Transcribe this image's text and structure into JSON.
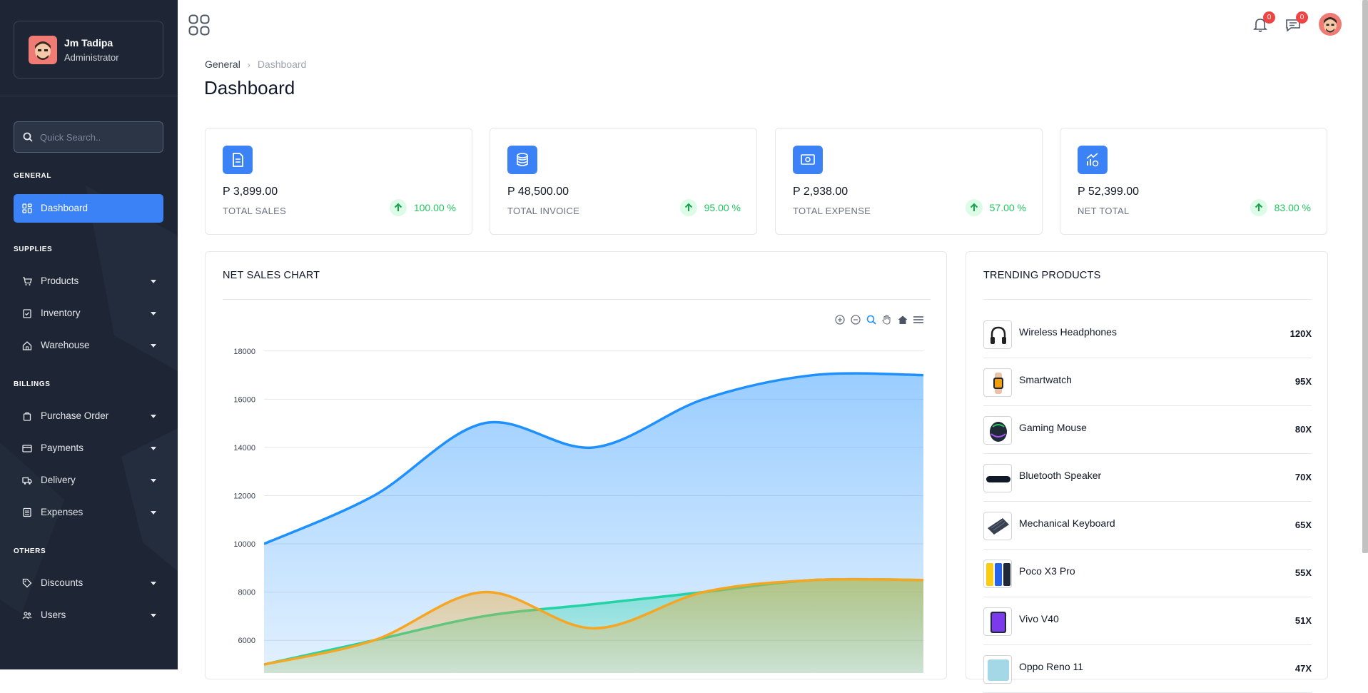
{
  "sidebar": {
    "profile": {
      "name": "Jm Tadipa",
      "role": "Administrator"
    },
    "search": {
      "placeholder": "Quick Search.."
    },
    "sections": [
      {
        "title": "GENERAL"
      },
      {
        "title": "SUPPLIES"
      },
      {
        "title": "BILLINGS"
      },
      {
        "title": "OTHERS"
      }
    ],
    "items": [
      {
        "label": "Dashboard",
        "icon": "grid-icon",
        "active": true
      },
      {
        "label": "Products",
        "icon": "cart-icon"
      },
      {
        "label": "Inventory",
        "icon": "clipboard-icon"
      },
      {
        "label": "Warehouse",
        "icon": "home-icon"
      },
      {
        "label": "Purchase Order",
        "icon": "bag-icon"
      },
      {
        "label": "Payments",
        "icon": "credit-card-icon"
      },
      {
        "label": "Delivery",
        "icon": "truck-icon"
      },
      {
        "label": "Expenses",
        "icon": "list-icon"
      },
      {
        "label": "Discounts",
        "icon": "tag-icon"
      },
      {
        "label": "Users",
        "icon": "users-icon"
      }
    ]
  },
  "topbar": {
    "notifications_count": "0",
    "messages_count": "0"
  },
  "breadcrumb": {
    "root": "General",
    "current": "Dashboard"
  },
  "page_title": "Dashboard",
  "stats": [
    {
      "amount": "P 3,899.00",
      "label": "TOTAL SALES",
      "percent": "100.00 %",
      "icon": "document-icon"
    },
    {
      "amount": "P 48,500.00",
      "label": "TOTAL INVOICE",
      "percent": "95.00 %",
      "icon": "coins-icon"
    },
    {
      "amount": "P 2,938.00",
      "label": "TOTAL EXPENSE",
      "percent": "57.00 %",
      "icon": "cash-icon"
    },
    {
      "amount": "P 52,399.00",
      "label": "NET TOTAL",
      "percent": "83.00 %",
      "icon": "growth-icon"
    }
  ],
  "net_sales": {
    "title": "NET SALES CHART"
  },
  "chart_data": {
    "type": "area",
    "title": "",
    "xlabel": "",
    "ylabel": "",
    "ylim": [
      5000,
      19000
    ],
    "yticks": [
      6000,
      8000,
      10000,
      12000,
      14000,
      16000,
      18000
    ],
    "grid": true,
    "x": [
      0,
      1,
      2,
      3,
      4,
      5,
      6
    ],
    "series": [
      {
        "values": [
          10000,
          12000,
          15000,
          14000,
          16000,
          17000,
          17000
        ],
        "color": "#1e90ff"
      },
      {
        "values": [
          5000,
          6000,
          7000,
          7500,
          8000,
          8500,
          8500
        ],
        "color": "#22d3a5"
      },
      {
        "values": [
          5000,
          6000,
          8000,
          6500,
          8000,
          8500,
          8500
        ],
        "color": "#f5a623"
      }
    ]
  },
  "trending": {
    "title": "TRENDING PRODUCTS",
    "products": [
      {
        "name": "Wireless Headphones",
        "qty": "120X"
      },
      {
        "name": "Smartwatch",
        "qty": "95X"
      },
      {
        "name": "Gaming Mouse",
        "qty": "80X"
      },
      {
        "name": "Bluetooth Speaker",
        "qty": "70X"
      },
      {
        "name": "Mechanical Keyboard",
        "qty": "65X"
      },
      {
        "name": "Poco X3 Pro",
        "qty": "55X"
      },
      {
        "name": "Vivo V40",
        "qty": "51X"
      },
      {
        "name": "Oppo Reno 11",
        "qty": "47X"
      }
    ]
  },
  "colors": {
    "sidebar_bg": "#1e2635",
    "accent": "#3b82f6",
    "positive": "#22c55e",
    "badge": "#ef4444"
  }
}
